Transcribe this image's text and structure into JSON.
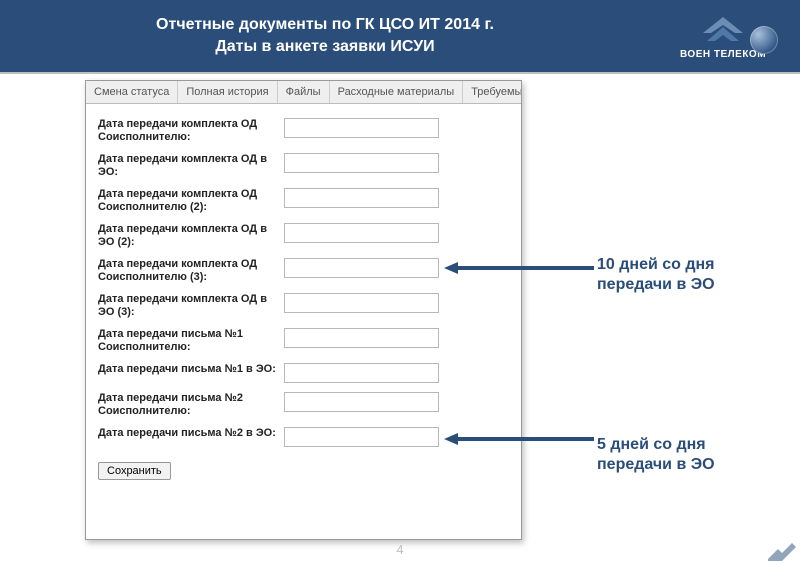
{
  "header": {
    "title_l1": "Отчетные документы по ГК ЦСО ИТ 2014 г.",
    "title_l2": "Даты в анкете заявки ИСУИ",
    "logo_text": "ВОЕН ТЕЛЕКОМ"
  },
  "tabs": [
    "Смена статуса",
    "Полная история",
    "Файлы",
    "Расходные материалы",
    "Требуемые мат"
  ],
  "form": {
    "rows": [
      {
        "label": "Дата передачи комплекта ОД Соисполнителю:"
      },
      {
        "label": "Дата передачи комплекта ОД в ЭО:"
      },
      {
        "label": "Дата передачи комплекта ОД Соисполнителю (2):"
      },
      {
        "label": "Дата передачи комплекта ОД в ЭО (2):"
      },
      {
        "label": "Дата передачи комплекта ОД Соисполнителю (3):"
      },
      {
        "label": "Дата передачи комплекта ОД в ЭО (3):"
      },
      {
        "label": "Дата передачи письма №1 Соисполнителю:"
      },
      {
        "label": "Дата передачи письма №1 в ЭО:"
      },
      {
        "label": "Дата передачи письма №2 Соисполнителю:"
      },
      {
        "label": "Дата передачи письма №2 в ЭО:"
      }
    ],
    "save_label": "Сохранить"
  },
  "annotations": {
    "a1": "10 дней со дня передачи в ЭО",
    "a2": "5 дней со дня передачи в ЭО"
  },
  "footer": {
    "page": "4"
  }
}
